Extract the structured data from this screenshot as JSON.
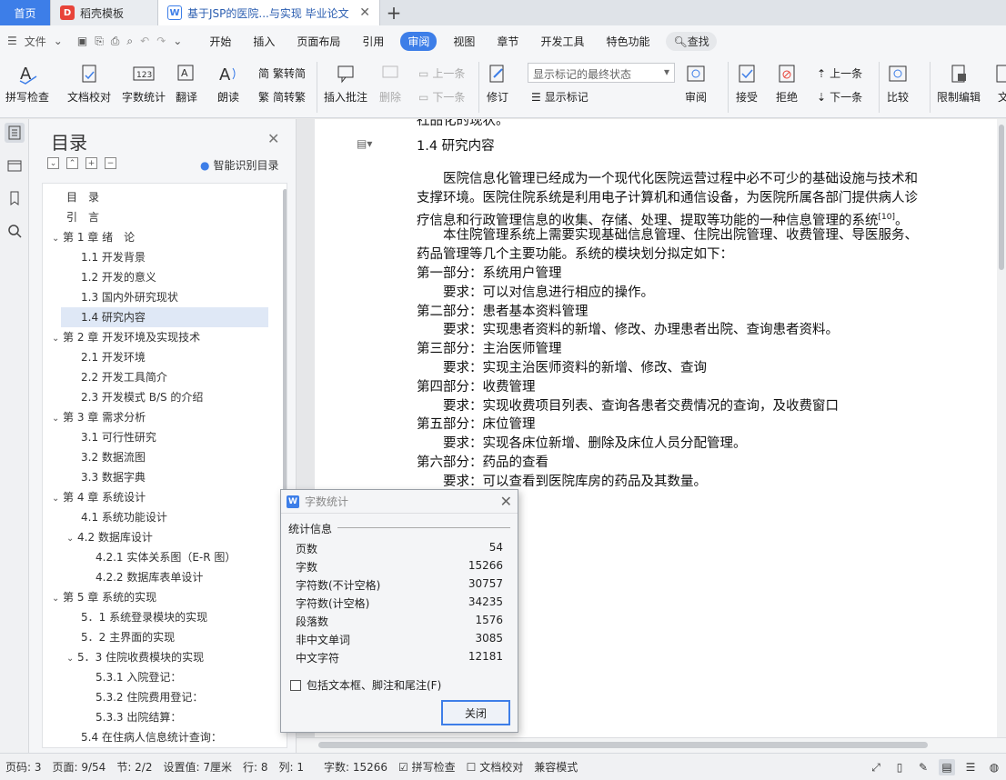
{
  "tabs": {
    "home": "首页",
    "template": "稻壳模板",
    "doc": "基于JSP的医院...与实现 毕业论文"
  },
  "menu": {
    "file": "文件",
    "items": [
      "开始",
      "插入",
      "页面布局",
      "引用",
      "审阅",
      "视图",
      "章节",
      "开发工具",
      "特色功能"
    ],
    "active": "审阅",
    "search": "查找"
  },
  "ribbon": {
    "spell": "拼写检查",
    "proof": "文档校对",
    "count": "字数统计",
    "translate": "翻译",
    "read": "朗读",
    "trad": "繁转简",
    "simp": "简转繁",
    "insert_comment": "插入批注",
    "delete": "删除",
    "prev_comment": "上一条",
    "next_comment": "下一条",
    "track": "修订",
    "show_mode": "显示标记的最终状态",
    "show_mark": "显示标记",
    "review": "审阅",
    "accept": "接受",
    "reject": "拒绝",
    "prev": "上一条",
    "next": "下一条",
    "compare": "比较",
    "restrict": "限制编辑",
    "doc_more": "文"
  },
  "toc": {
    "title": "目录",
    "smart": "智能识别目录",
    "items": [
      {
        "text": "目　录",
        "level": 0
      },
      {
        "text": "引　言",
        "level": 0
      },
      {
        "text": "第 1 章  绪　论",
        "level": 1
      },
      {
        "text": "1.1  开发背景",
        "level": 2
      },
      {
        "text": "1.2  开发的意义",
        "level": 2
      },
      {
        "text": "1.3  国内外研究现状",
        "level": 2
      },
      {
        "text": "1.4 研究内容",
        "level": 2
      },
      {
        "text": "第 2 章  开发环境及实现技术",
        "level": 1
      },
      {
        "text": "2.1 开发环境",
        "level": 2
      },
      {
        "text": "2.2 开发工具简介",
        "level": 2
      },
      {
        "text": "2.3 开发模式 B/S 的介绍",
        "level": 2
      },
      {
        "text": "第 3 章  需求分析",
        "level": 1
      },
      {
        "text": "3.1 可行性研究",
        "level": 2
      },
      {
        "text": "3.2  数据流图",
        "level": 2
      },
      {
        "text": "3.3  数据字典",
        "level": 2
      },
      {
        "text": "第 4 章  系统设计",
        "level": 1
      },
      {
        "text": "4.1 系统功能设计",
        "level": 2
      },
      {
        "text": "4.2  数据库设计",
        "level": 2
      },
      {
        "text": "4.2.1 实体关系图（E-R 图）",
        "level": 3
      },
      {
        "text": "4.2.2 数据库表单设计",
        "level": 3
      },
      {
        "text": "第 5 章  系统的实现",
        "level": 1
      },
      {
        "text": "5．1 系统登录模块的实现",
        "level": 2
      },
      {
        "text": "5．2 主界面的实现",
        "level": 2
      },
      {
        "text": "5．3 住院收费模块的实现",
        "level": 2
      },
      {
        "text": "5.3.1 入院登记：",
        "level": 3
      },
      {
        "text": "5.3.2 住院费用登记：",
        "level": 3
      },
      {
        "text": "5.3.3 出院结算：",
        "level": 3
      },
      {
        "text": "5.4 在住病人信息统计查询：",
        "level": 2
      }
    ],
    "selected": "1.4 研究内容"
  },
  "doc": {
    "cut_top": "社品化的现状。",
    "heading": "1.4 研究内容",
    "lines": [
      "　　医院信息化管理已经成为一个现代化医院运营过程中必不可少的基础设施与技术和",
      "支撑环境。医院住院系统是利用电子计算机和通信设备，为医院所属各部门提供病人诊",
      "疗信息和行政管理信息的收集、存储、处理、提取等功能的一种信息管理的系统",
      "　　本住院管理系统上需要实现基础信息管理、住院出院管理、收费管理、导医服务、",
      "药品管理等几个主要功能。系统的模块划分拟定如下：",
      "第一部分：系统用户管理",
      "　　要求：可以对信息进行相应的操作。",
      "第二部分：患者基本资料管理",
      "　　要求：实现患者资料的新增、修改、办理患者出院、查询患者资料。",
      "第三部分：主治医师管理",
      "　　要求：实现主治医师资料的新增、修改、查询",
      "第四部分：收费管理",
      "　　要求：实现收费项目列表、查询各患者交费情况的查询，及收费窗口",
      "第五部分：床位管理",
      "　　要求：实现各床位新增、删除及床位人员分配管理。",
      "第六部分：药品的查看",
      "　　要求：可以查看到医院库房的药品及其数量。"
    ],
    "cite": "[10]",
    "cite_tail": "。"
  },
  "dialog": {
    "title": "字数统计",
    "section": "统计信息",
    "rows": [
      {
        "label": "页数",
        "value": "54"
      },
      {
        "label": "字数",
        "value": "15266"
      },
      {
        "label": "字符数(不计空格)",
        "value": "30757"
      },
      {
        "label": "字符数(计空格)",
        "value": "34235"
      },
      {
        "label": "段落数",
        "value": "1576"
      },
      {
        "label": "非中文单词",
        "value": "3085"
      },
      {
        "label": "中文字符",
        "value": "12181"
      }
    ],
    "checkbox": "包括文本框、脚注和尾注(F)",
    "close": "关闭"
  },
  "status": {
    "page": "页码: 3",
    "pages": "页面: 9/54",
    "section": "节: 2/2",
    "setting": "设置值: 7厘米",
    "row": "行: 8",
    "col": "列: 1",
    "words": "字数: 15266",
    "spell": "拼写检查",
    "proof": "文档校对",
    "compat": "兼容模式"
  },
  "colors": {
    "accent": "#3d7ee8",
    "selected": "#dfe8f6"
  }
}
